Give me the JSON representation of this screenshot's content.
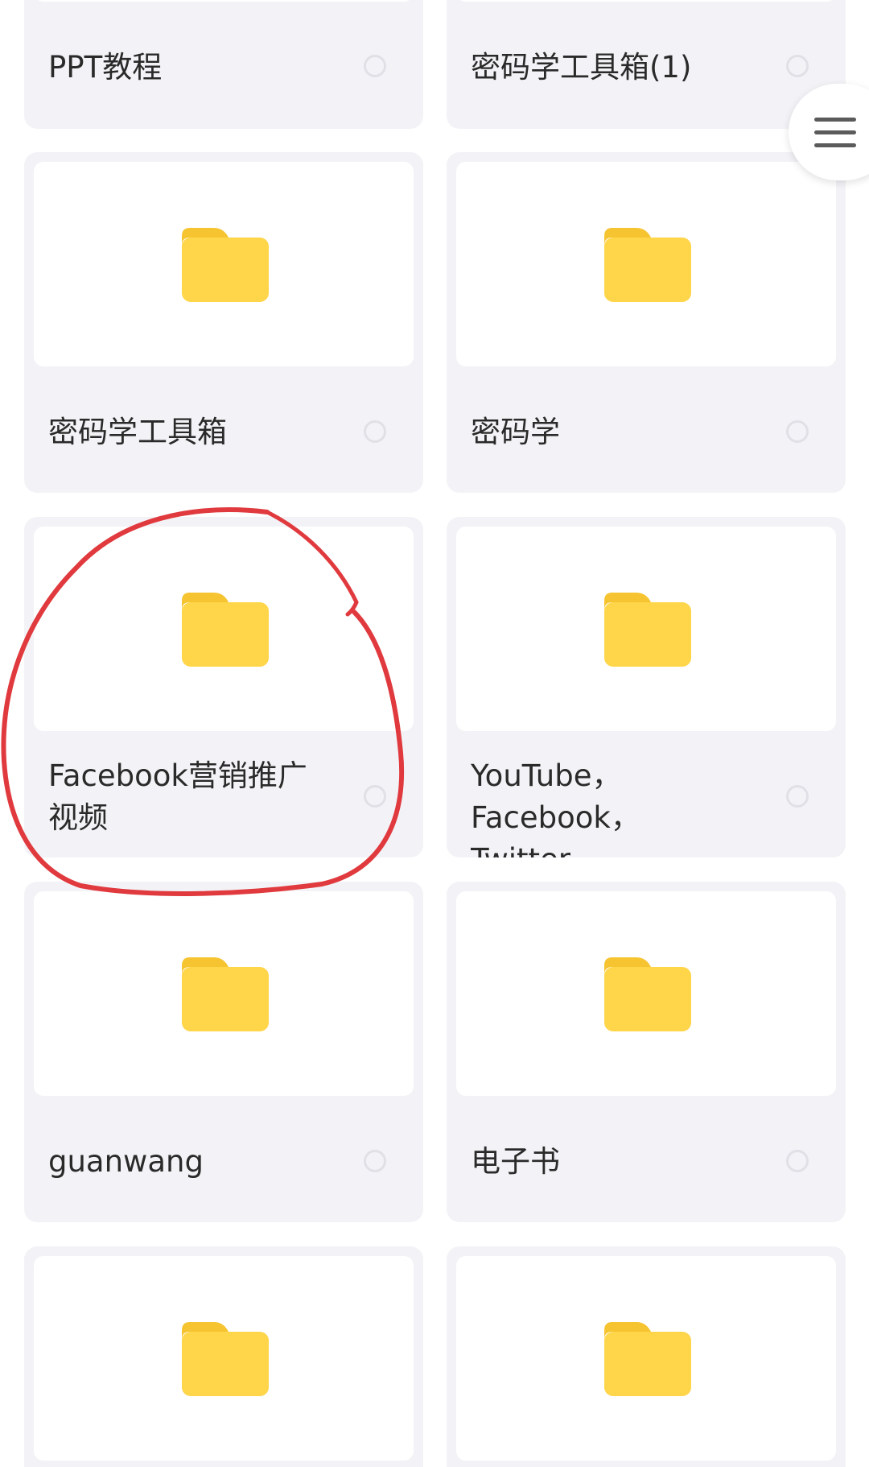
{
  "folders": [
    {
      "name": "PPT教程"
    },
    {
      "name": "密码学工具箱(1)"
    },
    {
      "name": "密码学工具箱"
    },
    {
      "name": "密码学"
    },
    {
      "name": "Facebook营销推广\n视频"
    },
    {
      "name": "YouTube，\nFacebook，Twitter..."
    },
    {
      "name": "guanwang"
    },
    {
      "name": "电子书"
    },
    {
      "name": ""
    },
    {
      "name": ""
    }
  ],
  "menu_button": {
    "icon": "hamburger-menu-icon"
  },
  "folder_icon": {
    "icon": "folder-icon",
    "color": "#ffd54a",
    "tab_color": "#f6c431"
  },
  "annotation": {
    "type": "hand-drawn-circle",
    "color": "#e03a3e"
  }
}
